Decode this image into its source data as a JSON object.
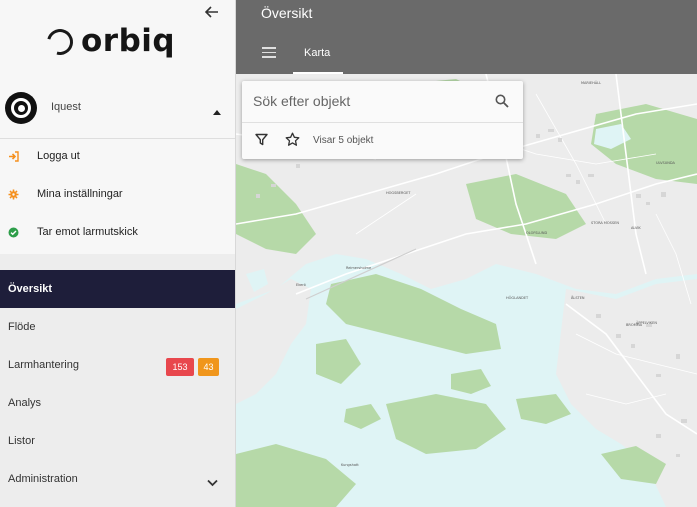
{
  "brand": {
    "logo_text": "orbiq"
  },
  "user": {
    "name": "Iquest"
  },
  "user_menu": [
    {
      "label": "Logga ut",
      "icon": "logout-icon",
      "color": "#f5901e"
    },
    {
      "label": "Mina inställningar",
      "icon": "gear-icon",
      "color": "#f5901e"
    },
    {
      "label": "Tar emot larmutskick",
      "icon": "check-circle-icon",
      "color": "#2e9e4a"
    }
  ],
  "nav": {
    "items": [
      {
        "label": "Översikt",
        "active": true
      },
      {
        "label": "Flöde"
      },
      {
        "label": "Larmhantering",
        "badges": [
          "153",
          "43"
        ]
      },
      {
        "label": "Analys"
      },
      {
        "label": "Listor"
      },
      {
        "label": "Administration",
        "icon": "chevron-down-icon"
      }
    ]
  },
  "header": {
    "title": "Översikt",
    "tabs": [
      {
        "label": "Karta",
        "active": true
      }
    ]
  },
  "search": {
    "placeholder": "Sök efter objekt",
    "shown_text": "Visar 5 objekt"
  },
  "colors": {
    "sidebar_active": "#1e1e3a",
    "header": "#6a6a6a",
    "badge_red": "#e8474d",
    "badge_orange": "#f0961c",
    "map_water": "#dff4f5",
    "map_green": "#b6d9a8",
    "map_land": "#ececec"
  }
}
